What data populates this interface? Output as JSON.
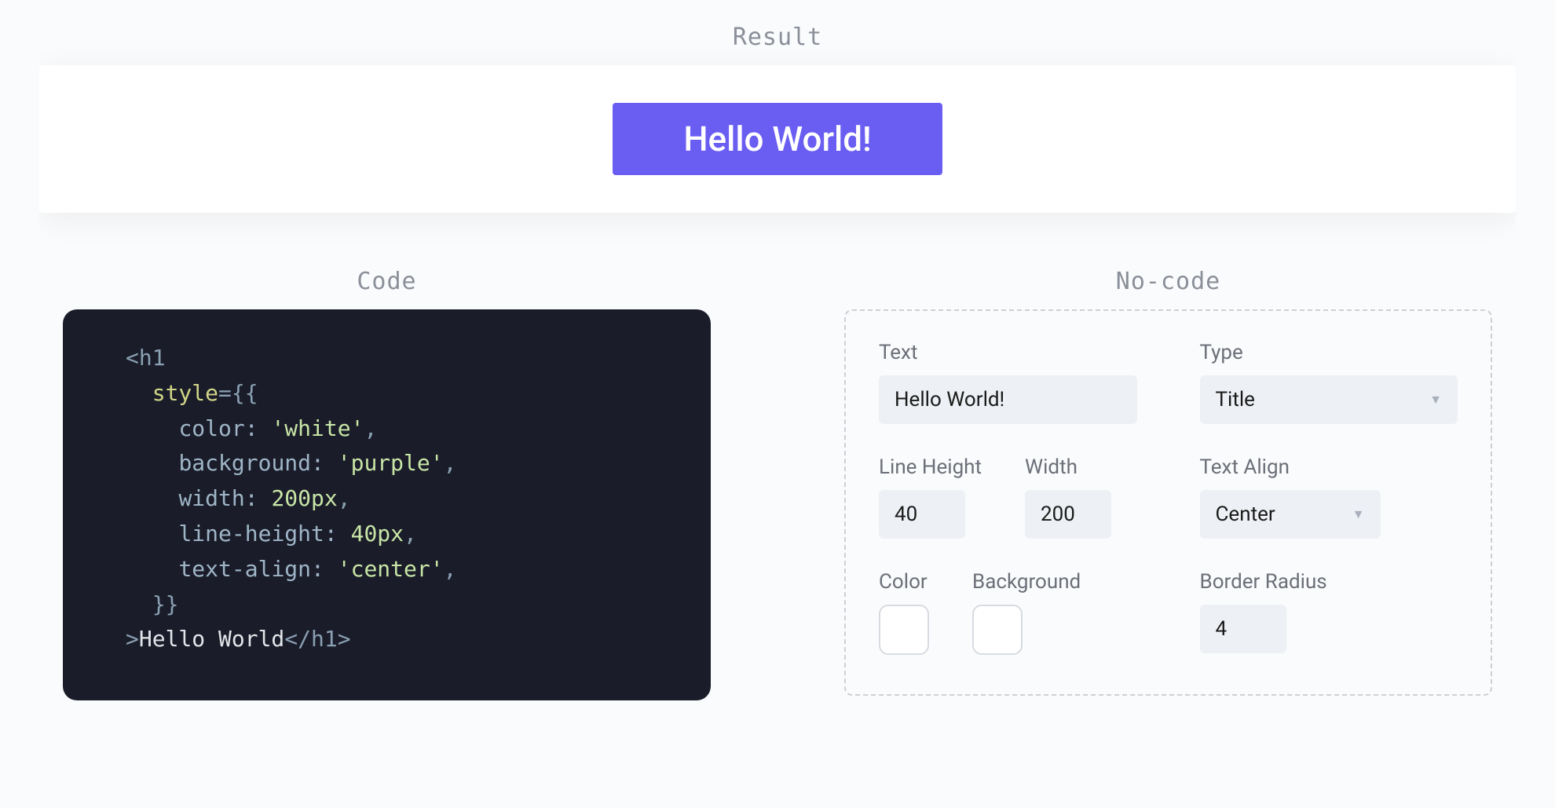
{
  "sections": {
    "result_label": "Result",
    "code_label": "Code",
    "nocode_label": "No-code"
  },
  "preview": {
    "text": "Hello World!",
    "bg_color": "#6a5ef2",
    "text_color": "#ffffff"
  },
  "code": {
    "line1_open": "<h1",
    "line2_attr": "style",
    "line2_eq": "={{",
    "line3_key": "color:",
    "line3_val": "'white'",
    "line3_c": ",",
    "line4_key": "background:",
    "line4_val": "'purple'",
    "line4_c": ",",
    "line5_key": "width:",
    "line5_val": "200px",
    "line5_c": ",",
    "line6_key": "line-height:",
    "line6_val": "40px",
    "line6_c": ",",
    "line7_key": "text-align:",
    "line7_val": "'center'",
    "line7_c": ",",
    "line8_close": "}}",
    "line9_gt": ">",
    "line9_txt": "Hello World",
    "line9_end": "</h1>"
  },
  "nocode": {
    "text_label": "Text",
    "text_value": "Hello World!",
    "type_label": "Type",
    "type_value": "Title",
    "line_height_label": "Line Height",
    "line_height_value": "40",
    "width_label": "Width",
    "width_value": "200",
    "text_align_label": "Text Align",
    "text_align_value": "Center",
    "color_label": "Color",
    "color_value": "#ffffff",
    "background_label": "Background",
    "background_value": "#ffffff",
    "border_radius_label": "Border Radius",
    "border_radius_value": "4"
  }
}
